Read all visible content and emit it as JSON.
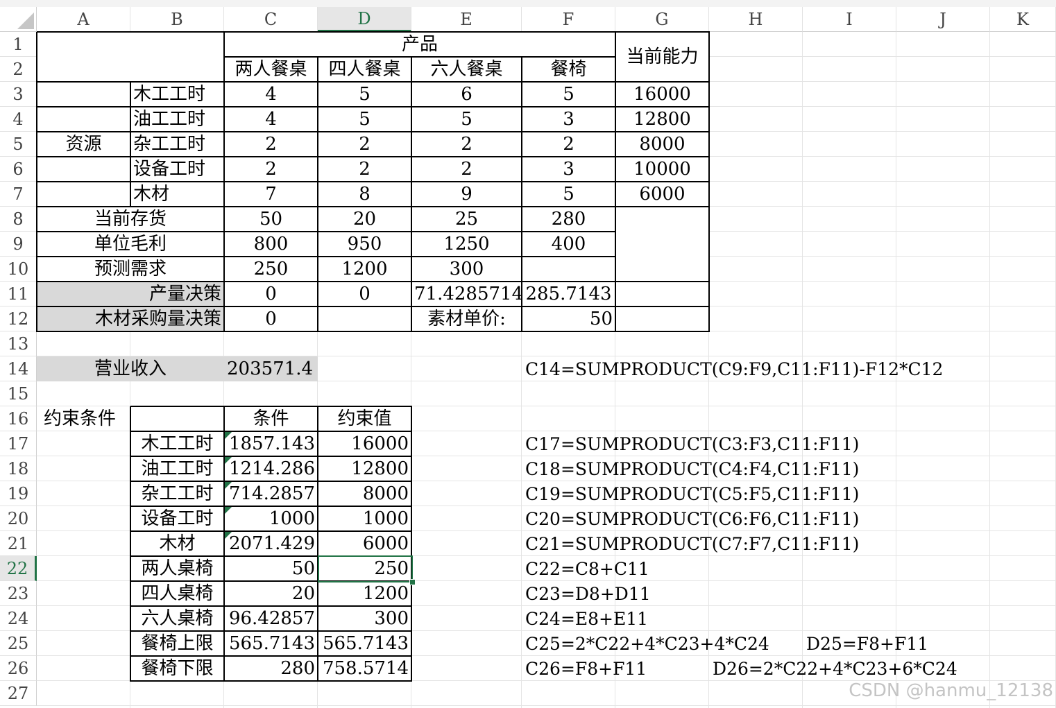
{
  "columns": [
    "A",
    "B",
    "C",
    "D",
    "E",
    "F",
    "G",
    "H",
    "I",
    "J",
    "K"
  ],
  "selected_column": "D",
  "rows": [
    "1",
    "2",
    "3",
    "4",
    "5",
    "6",
    "7",
    "8",
    "9",
    "10",
    "11",
    "12",
    "13",
    "14",
    "15",
    "16",
    "17",
    "18",
    "19",
    "20",
    "21",
    "22",
    "23",
    "24",
    "25",
    "26",
    "27"
  ],
  "selected_row": "22",
  "table": {
    "product_header": "产品",
    "products": [
      "两人餐桌",
      "四人餐桌",
      "六人餐桌",
      "餐椅"
    ],
    "capacity_header": "当前能力",
    "resource_group": "资源",
    "resources": [
      {
        "name": "木工工时",
        "values": [
          "4",
          "5",
          "6",
          "5"
        ],
        "capacity": "16000"
      },
      {
        "name": "油工工时",
        "values": [
          "4",
          "5",
          "5",
          "3"
        ],
        "capacity": "12800"
      },
      {
        "name": "杂工工时",
        "values": [
          "2",
          "2",
          "2",
          "2"
        ],
        "capacity": "8000"
      },
      {
        "name": "设备工时",
        "values": [
          "2",
          "2",
          "2",
          "3"
        ],
        "capacity": "10000"
      },
      {
        "name": "木材",
        "values": [
          "7",
          "8",
          "9",
          "5"
        ],
        "capacity": "6000"
      }
    ],
    "inventory": {
      "label": "当前存货",
      "values": [
        "50",
        "20",
        "25",
        "280"
      ]
    },
    "margin": {
      "label": "单位毛利",
      "values": [
        "800",
        "950",
        "1250",
        "400"
      ]
    },
    "demand": {
      "label": "预测需求",
      "values": [
        "250",
        "1200",
        "300"
      ]
    },
    "production": {
      "label": "产量决策",
      "values": [
        "0",
        "0",
        "71.4285714",
        "285.7143"
      ]
    },
    "purchase": {
      "label": "木材采购量决策",
      "value": "0",
      "price_label": "素材单价:",
      "price": "50"
    },
    "revenue": {
      "label": "营业收入",
      "value": "203571.4"
    }
  },
  "constraints": {
    "title": "约束条件",
    "header_condition": "条件",
    "header_value": "约束值",
    "rows": [
      {
        "name": "木工工时",
        "condition": "1857.143",
        "limit": "16000"
      },
      {
        "name": "油工工时",
        "condition": "1214.286",
        "limit": "12800"
      },
      {
        "name": "杂工工时",
        "condition": "714.2857",
        "limit": "8000"
      },
      {
        "name": "设备工时",
        "condition": "1000",
        "limit": "1000"
      },
      {
        "name": "木材",
        "condition": "2071.429",
        "limit": "6000"
      },
      {
        "name": "两人桌椅",
        "condition": "50",
        "limit": "250"
      },
      {
        "name": "四人桌椅",
        "condition": "20",
        "limit": "1200"
      },
      {
        "name": "六人桌椅",
        "condition": "96.42857",
        "limit": "300"
      },
      {
        "name": "餐椅上限",
        "condition": "565.7143",
        "limit": "565.7143"
      },
      {
        "name": "餐椅下限",
        "condition": "280",
        "limit": "758.5714"
      }
    ]
  },
  "formulas": {
    "c14": "C14=SUMPRODUCT(C9:F9,C11:F11)-F12*C12",
    "c17": "C17=SUMPRODUCT(C3:F3,C11:F11)",
    "c18": "C18=SUMPRODUCT(C4:F4,C11:F11)",
    "c19": "C19=SUMPRODUCT(C5:F5,C11:F11)",
    "c20": "C20=SUMPRODUCT(C6:F6,C11:F11)",
    "c21": "C21=SUMPRODUCT(C7:F7,C11:F11)",
    "c22": "C22=C8+C11",
    "c23": "C23=D8+D11",
    "c24": "C24=E8+E11",
    "c25": "C25=2*C22+4*C23+4*C24",
    "d25": "D25=F8+F11",
    "c26": "C26=F8+F11",
    "d26": "D26=2*C22+4*C23+6*C24"
  },
  "watermark": "CSDN @hanmu_12138"
}
